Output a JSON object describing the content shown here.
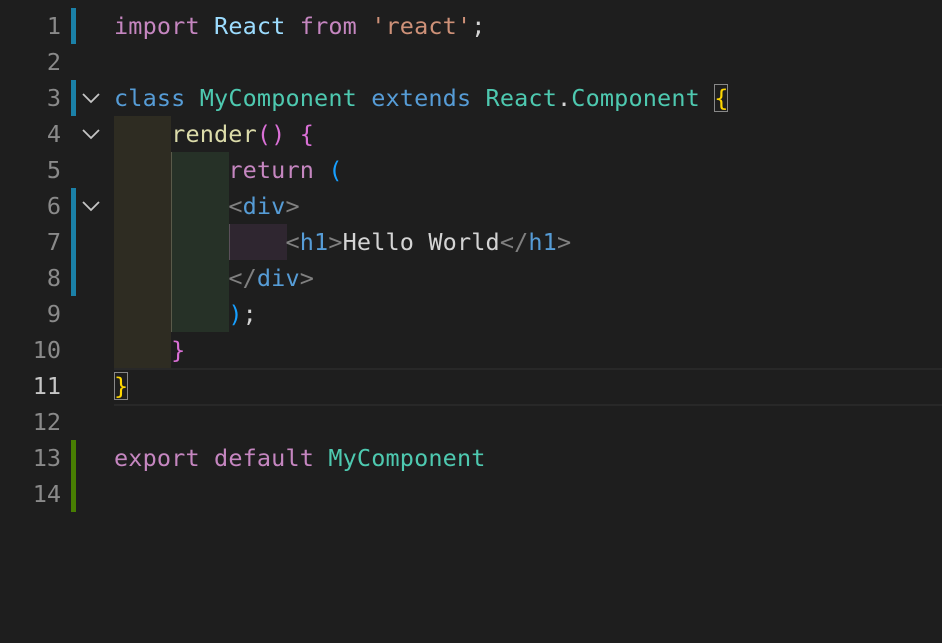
{
  "colors": {
    "background": "#1e1e1e",
    "gutter_modified": "#1b81a8",
    "gutter_added": "#487e02"
  },
  "line_numbers": [
    "1",
    "2",
    "3",
    "4",
    "5",
    "6",
    "7",
    "8",
    "9",
    "10",
    "11",
    "12",
    "13",
    "14"
  ],
  "active_line": "11",
  "code": {
    "l1": {
      "import": "import",
      "react_id": "React",
      "from": "from",
      "module": "'react'",
      "semi": ";"
    },
    "l3": {
      "class": "class",
      "name": "MyComponent",
      "extends": "extends",
      "react": "React",
      "dot": ".",
      "component": "Component",
      "open": "{"
    },
    "l4": {
      "method": "render",
      "parens": "()",
      "open": "{"
    },
    "l5": {
      "return": "return",
      "open": "("
    },
    "l6": {
      "lt": "<",
      "tag": "div",
      "gt": ">"
    },
    "l7": {
      "lt": "<",
      "tag": "h1",
      "gt": ">",
      "text": "Hello World",
      "lt2": "</",
      "tag2": "h1",
      "gt2": ">"
    },
    "l8": {
      "lt": "</",
      "tag": "div",
      "gt": ">"
    },
    "l9": {
      "close": ")",
      "semi": ";"
    },
    "l10": {
      "close": "}"
    },
    "l11": {
      "close": "}"
    },
    "l13": {
      "export": "export",
      "default": "default",
      "name": "MyComponent"
    }
  },
  "gutter": {
    "modified_lines": [
      "1",
      "3",
      "6",
      "7",
      "8"
    ],
    "added_lines": [
      "13",
      "14"
    ]
  },
  "fold_icons": [
    "chevron-down-icon"
  ]
}
